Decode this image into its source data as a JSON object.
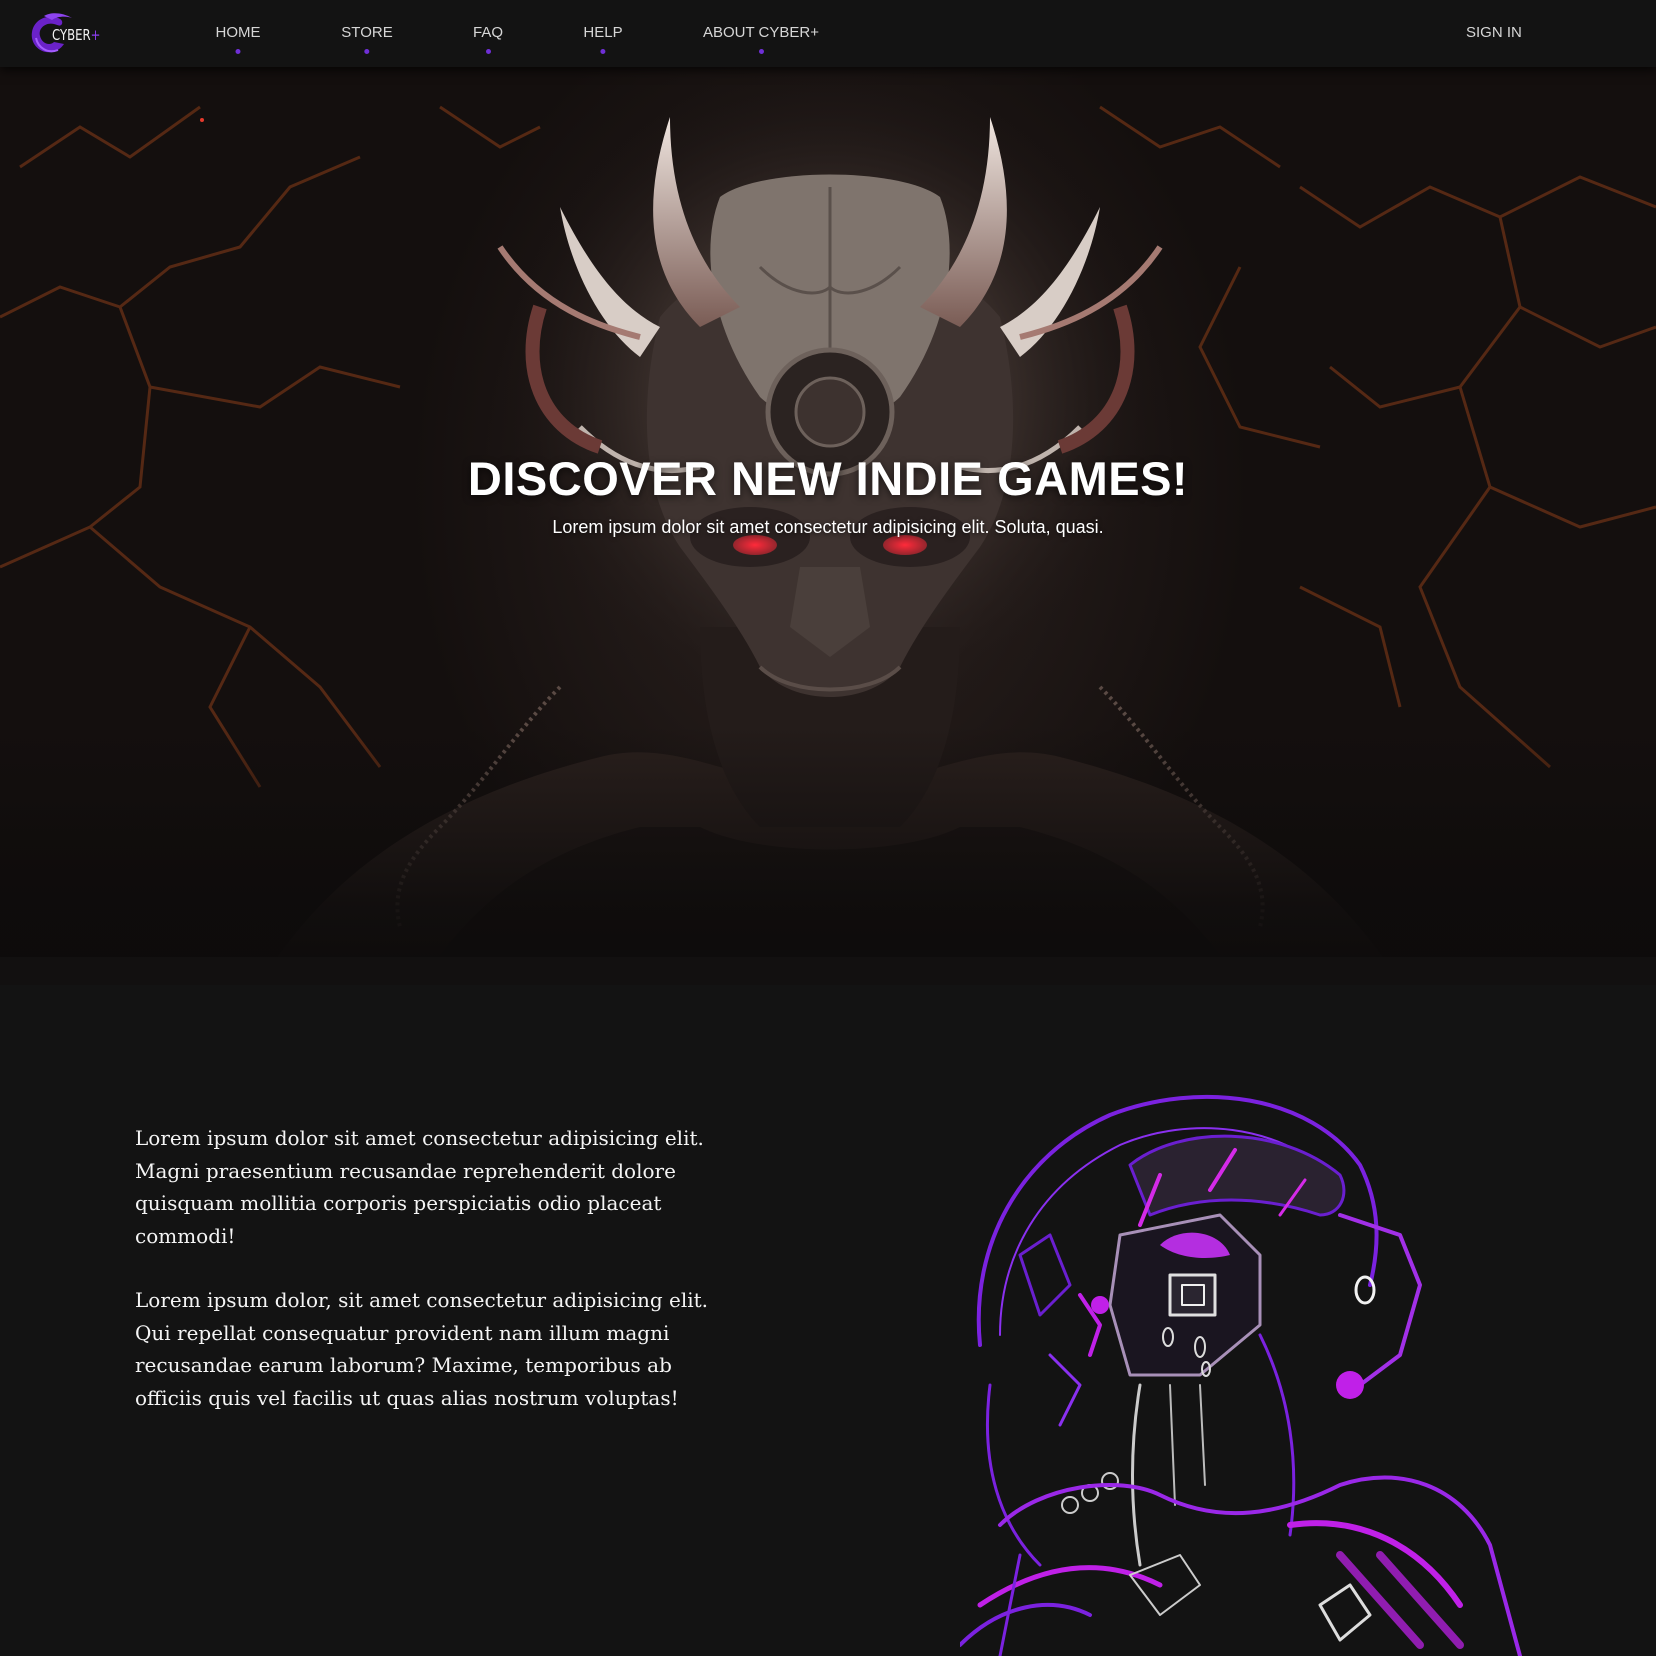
{
  "navbar": {
    "logo": {
      "text": "CYBER",
      "plus": "+"
    },
    "items": [
      {
        "label": "HOME"
      },
      {
        "label": "STORE"
      },
      {
        "label": "FAQ"
      },
      {
        "label": "HELP"
      },
      {
        "label": "ABOUT CYBER+"
      }
    ],
    "signin_label": "SIGN IN"
  },
  "hero": {
    "title": "DISCOVER NEW INDIE GAMES!",
    "subtitle": "Lorem ipsum dolor sit amet consectetur adipisicing elit. Soluta, quasi."
  },
  "about": {
    "paragraphs": [
      "Lorem ipsum dolor sit amet consectetur adipisicing elit. Magni praesentium recusandae reprehenderit dolore quisquam mollitia corporis perspiciatis odio placeat commodi!",
      "Lorem ipsum dolor, sit amet consectetur adipisicing elit. Qui repellat consequatur provident nam illum magni recusandae earum laborum? Maxime, temporibus ab officiis quis vel facilis ut quas alias nostrum voluptas!"
    ]
  },
  "colors": {
    "accent": "#6f2fd6",
    "background": "#131313",
    "neon_magenta": "#c020e8",
    "neon_purple": "#7b22e0"
  },
  "icons": {
    "logo": "cyber-logo-icon"
  }
}
